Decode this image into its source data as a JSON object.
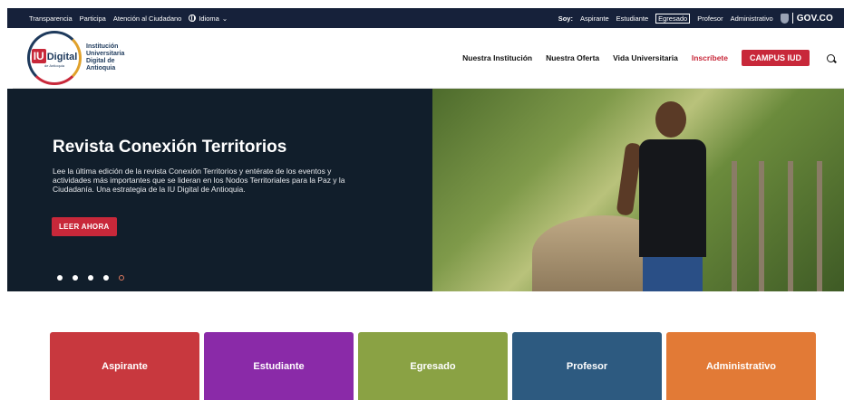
{
  "topbar": {
    "links": [
      "Transparencia",
      "Participa",
      "Atención al Ciudadano"
    ],
    "language_label": "Idioma",
    "soy_label": "Soy:",
    "roles": [
      "Aspirante",
      "Estudiante",
      "Egresado",
      "Profesor",
      "Administrativo"
    ],
    "selected_role": "Egresado",
    "gov_label": "GOV.CO"
  },
  "logo": {
    "iu": "IU",
    "digital": "Digital",
    "sub": "de Antioquia",
    "name_lines": [
      "Institución",
      "Universitaria",
      "Digital de",
      "Antioquia"
    ]
  },
  "nav": {
    "items": [
      "Nuestra Institución",
      "Nuestra Oferta",
      "Vida Universitaria"
    ],
    "highlight": "Inscríbete",
    "campus_button": "CAMPUS IUD"
  },
  "hero": {
    "title": "Revista Conexión Territorios",
    "description": "Lee la última edición de la revista Conexión Territorios y entérate de los eventos y actividades más importantes que se lideran en los Nodos Territoriales para la Paz y la Ciudadanía. Una estrategia de la IU Digital de Antioquia.",
    "button": "LEER AHORA",
    "slide_count": 5,
    "active_slide": 5
  },
  "cards": [
    {
      "label": "Aspirante",
      "color": "#c8383e"
    },
    {
      "label": "Estudiante",
      "color": "#8a2aa8"
    },
    {
      "label": "Egresado",
      "color": "#8aa244"
    },
    {
      "label": "Profesor",
      "color": "#2d5a80"
    },
    {
      "label": "Administrativo",
      "color": "#e27a36"
    }
  ],
  "colors": {
    "topbar": "#16213a",
    "accent_red": "#c8283a",
    "hero_bg": "#111e2b"
  }
}
